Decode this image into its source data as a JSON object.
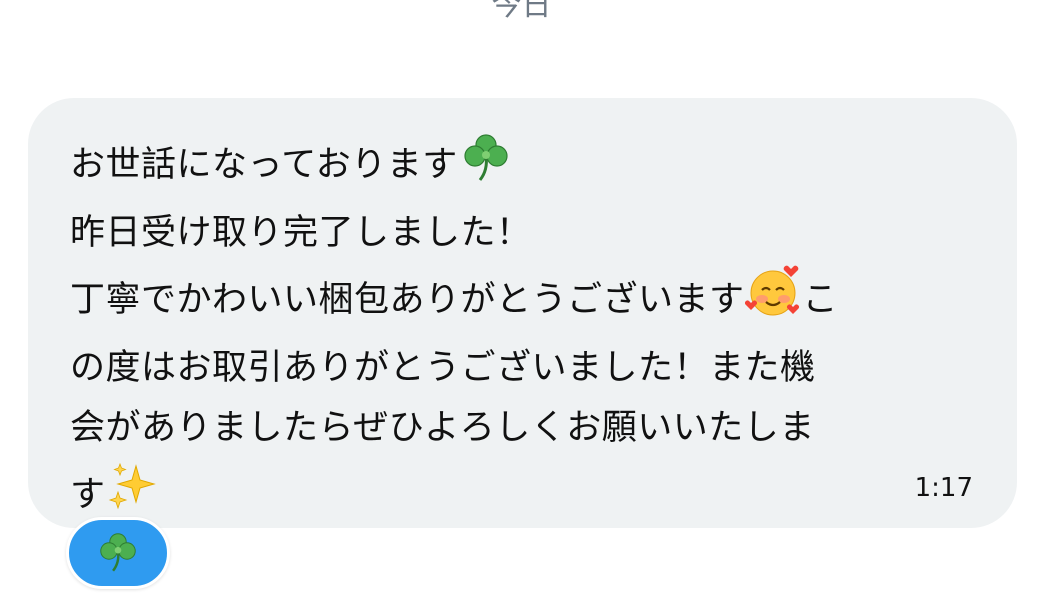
{
  "date_divider": "今日",
  "message": {
    "lines": [
      "お世話になっております",
      "昨日受け取り完了しました！",
      "丁寧でかわいい梱包ありがとうございます",
      "この度はお取引ありがとうございました！また機",
      "会がありましたらぜひよろしくお願いいたしま",
      "す"
    ],
    "line1_tail_emoji": "clover-icon",
    "line3_tail_emoji": "smiling-face-with-hearts-icon",
    "line3_after_emoji": "こ",
    "line4_text": "の度はお取引ありがとうございました！また機",
    "line6_tail_emoji": "sparkles-icon",
    "time": "1:17"
  },
  "reaction": {
    "emoji": "clover-icon",
    "color": "#2f9bf0"
  },
  "colors": {
    "bubble_bg": "#eff2f3",
    "text": "#111111",
    "divider_text": "#6f7a86"
  }
}
